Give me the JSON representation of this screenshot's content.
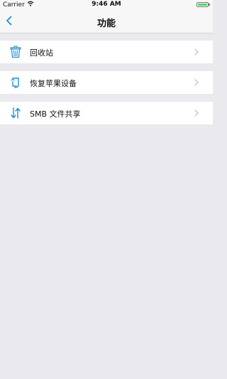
{
  "status_bar": {
    "carrier": "Carrier",
    "time": "9:46 AM",
    "battery_level": 1.0
  },
  "nav": {
    "title": "功能",
    "back_icon": "chevron-left-icon"
  },
  "menu": [
    {
      "label": "回收站",
      "icon": "trash-icon"
    },
    {
      "label": "恢复苹果设备",
      "icon": "restore-arrow-icon"
    },
    {
      "label": "SMB 文件共享",
      "icon": "transfer-arrows-icon"
    }
  ],
  "colors": {
    "accent": "#1a8fd8",
    "background": "#e9e9ee",
    "chevron": "#c4c4c9"
  }
}
